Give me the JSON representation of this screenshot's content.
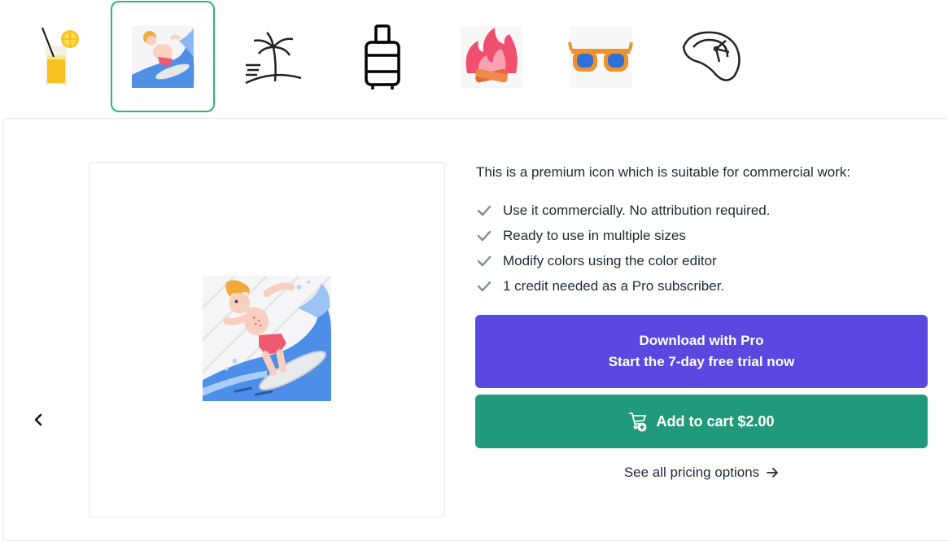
{
  "thumbnails": [
    {
      "name": "lemonade-icon",
      "active": false
    },
    {
      "name": "surfer-icon",
      "active": true
    },
    {
      "name": "palm-beach-icon",
      "active": false
    },
    {
      "name": "suitcase-icon",
      "active": false
    },
    {
      "name": "campfire-icon",
      "active": false
    },
    {
      "name": "sunglasses-icon",
      "active": false
    },
    {
      "name": "sun-hat-icon",
      "active": false
    }
  ],
  "preview": {
    "icon": "surfer-icon"
  },
  "info": {
    "title": "This is a premium icon which is suitable for commercial work:",
    "features": [
      "Use it commercially. No attribution required.",
      "Ready to use in multiple sizes",
      "Modify colors using the color editor",
      "1 credit needed as a Pro subscriber."
    ]
  },
  "buttons": {
    "pro_line1": "Download with Pro",
    "pro_line2": "Start the 7-day free trial now",
    "cart_label": "Add to cart $2.00",
    "pricing_link": "See all pricing options"
  },
  "colors": {
    "accent_purple": "#5a48e0",
    "accent_green": "#209a78",
    "active_border": "#2fb872",
    "check": "#7c8ba1"
  }
}
